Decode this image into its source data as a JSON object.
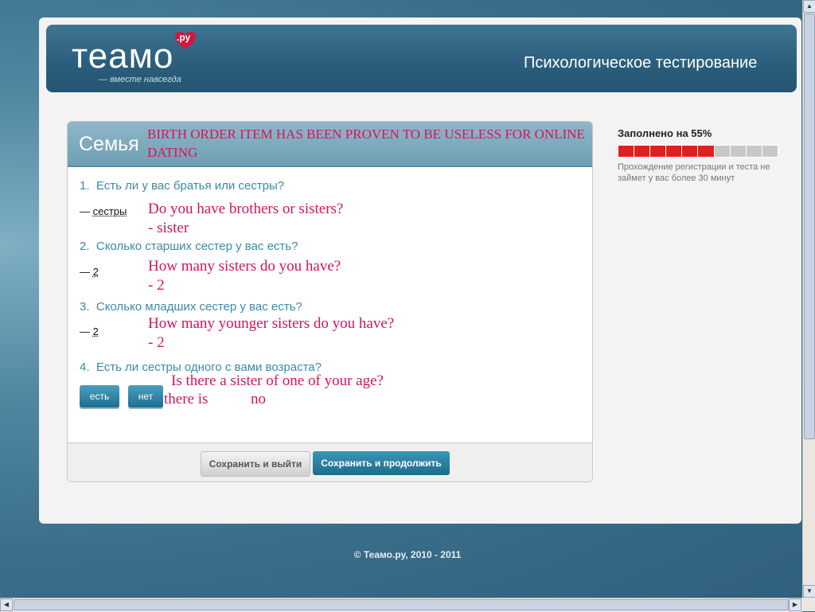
{
  "header": {
    "logo_text": "теамо",
    "logo_ru": ".ру",
    "slogan": "— вместе навсегда",
    "title": "Психологическое тестирование"
  },
  "panel": {
    "title": "Семья",
    "annotation": "BIRTH ORDER ITEM HAS BEEN PROVEN TO BE USELESS FOR ONLINE DATING",
    "questions": [
      {
        "number": "1.",
        "text": "Есть ли у вас братья или сестры?",
        "answer_dash": "—",
        "answer": "сестры",
        "annotation_line1": "Do you have brothers or sisters?",
        "annotation_line2": "- sister"
      },
      {
        "number": "2.",
        "text": "Сколько старших сестер у вас есть?",
        "answer_dash": "—",
        "answer": "2",
        "annotation_line1": "How many sisters do you have?",
        "annotation_line2": "- 2"
      },
      {
        "number": "3.",
        "text": "Сколько младших сестер у вас есть?",
        "answer_dash": "—",
        "answer": "2",
        "annotation_line1": "How many younger sisters do you have?",
        "annotation_line2": "- 2"
      },
      {
        "number": "4.",
        "text": "Есть ли сестры одного с вами возраста?",
        "annotation_line1": "Is there a sister of one of your age?",
        "annotation_yes": "there is",
        "annotation_no": "no"
      }
    ],
    "choice_yes": "есть",
    "choice_no": "нет",
    "save_exit": "Сохранить и выйти",
    "save_continue": "Сохранить и продолжить"
  },
  "progress": {
    "label": "Заполнено на 55%",
    "percent": 55,
    "segments_total": 10,
    "segments_filled": 6,
    "filled_color": "#e02020",
    "empty_color": "#c8c8c8",
    "note": "Прохождение регистрации и теста не займет у вас более 30 минут"
  },
  "footer": {
    "copyright": "© Теамо.ру, 2010 - 2011"
  },
  "colors": {
    "accent": "#2c5f7d",
    "annotation": "#d4145a"
  }
}
